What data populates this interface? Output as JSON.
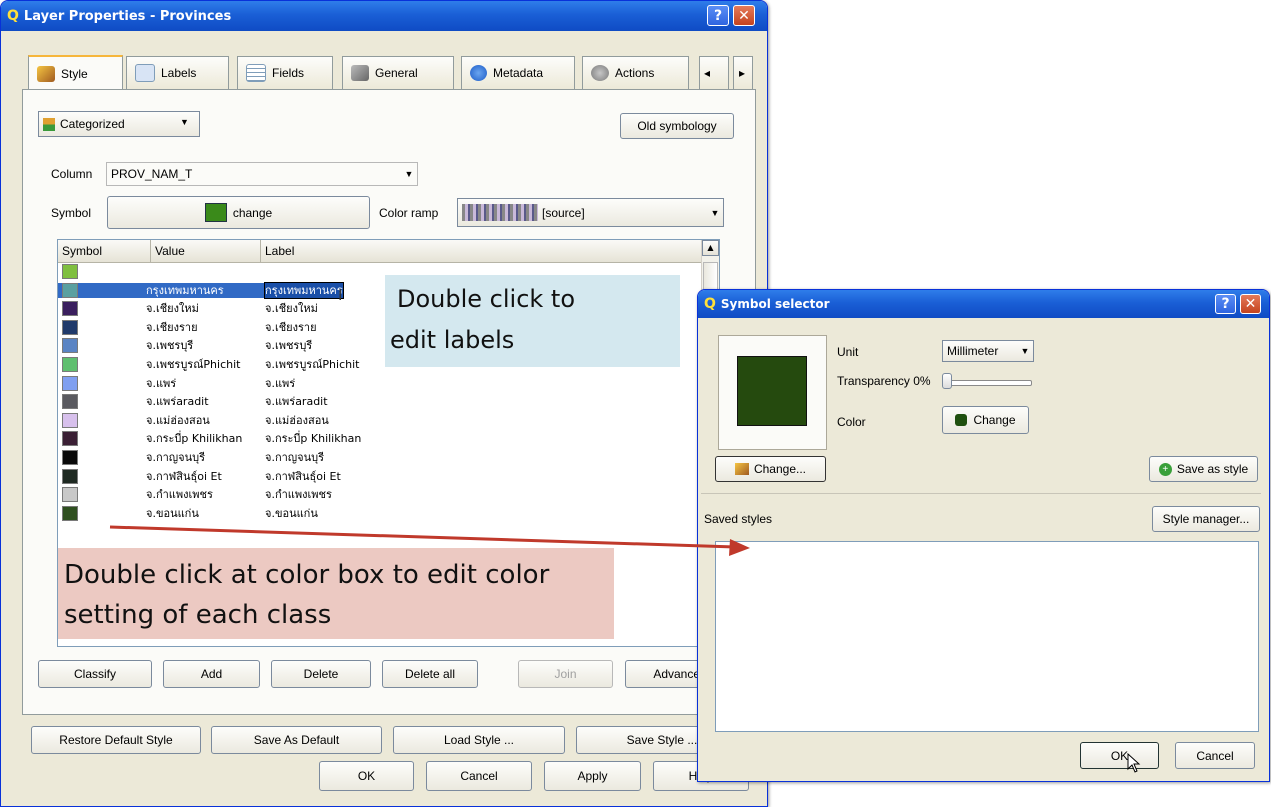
{
  "layer_window": {
    "title": "Layer Properties - Provinces",
    "tabs": [
      "Style",
      "Labels",
      "Fields",
      "General",
      "Metadata",
      "Actions"
    ],
    "renderer": "Categorized",
    "old_symbology": "Old symbology",
    "column_label": "Column",
    "column_value": "PROV_NAM_T",
    "symbol_label": "Symbol",
    "symbol_change": "change",
    "color_ramp_label": "Color ramp",
    "color_ramp_value": "[source]",
    "table_headers": [
      "Symbol",
      "Value",
      "Label"
    ],
    "rows": [
      {
        "color": "#7fbf3f",
        "value": "",
        "label": ""
      },
      {
        "color": "#5aa0a0",
        "value": "กรุงเทพมหานคร",
        "label": "กรุงเทพมหานคร"
      },
      {
        "color": "#3a1f5e",
        "value": "จ.เชียงใหม่",
        "label": "จ.เชียงใหม่"
      },
      {
        "color": "#203a6b",
        "value": "จ.เชียงราย",
        "label": "จ.เชียงราย"
      },
      {
        "color": "#5a84c4",
        "value": "จ.เพชรบุรี",
        "label": "จ.เพชรบุรี"
      },
      {
        "color": "#5fbf6f",
        "value": "จ.เพชรบูรณ์Phichit",
        "label": "จ.เพชรบูรณ์Phichit"
      },
      {
        "color": "#7f9ff0",
        "value": "จ.แพร่",
        "label": "จ.แพร่"
      },
      {
        "color": "#5a5a60",
        "value": "จ.แพร่aradit",
        "label": "จ.แพร่aradit"
      },
      {
        "color": "#d7c0ec",
        "value": "จ.แม่ฮ่องสอน",
        "label": "จ.แม่ฮ่องสอน"
      },
      {
        "color": "#3b2035",
        "value": "จ.กระบี่p Khilikhan",
        "label": "จ.กระบี่p Khilikhan"
      },
      {
        "color": "#0a0a0a",
        "value": "จ.กาญจนบุรี",
        "label": "จ.กาญจนบุรี"
      },
      {
        "color": "#1f2a22",
        "value": "จ.กาฬสินธุ์oi Et",
        "label": "จ.กาฬสินธุ์oi Et"
      },
      {
        "color": "#c8c8c8",
        "value": "จ.กำแพงเพชร",
        "label": "จ.กำแพงเพชร"
      },
      {
        "color": "#2f5020",
        "value": "จ.ขอนแก่น",
        "label": "จ.ขอนแก่น"
      }
    ],
    "buttons": [
      "Classify",
      "Add",
      "Delete",
      "Delete all",
      "Join",
      "Advanced"
    ],
    "bottom_buttons": [
      "Restore Default Style",
      "Save As Default",
      "Load Style ...",
      "Save Style ..."
    ],
    "dialog_buttons": [
      "OK",
      "Cancel",
      "Apply",
      "Help"
    ]
  },
  "symbol_window": {
    "title": "Symbol selector",
    "unit_label": "Unit",
    "unit_value": "Millimeter",
    "transparency_label": "Transparency 0%",
    "color_label": "Color",
    "color_change": "Change",
    "change_button": "Change...",
    "save_as_style": "Save as style",
    "saved_styles_label": "Saved styles",
    "style_manager": "Style manager...",
    "ok": "OK",
    "cancel": "Cancel",
    "symbol_color": "#254a0e"
  },
  "callouts": {
    "labels_line1": "Double click to",
    "labels_line2": "edit labels",
    "color_line1": "Double click at color box to edit color",
    "color_line2": "setting of each class"
  }
}
